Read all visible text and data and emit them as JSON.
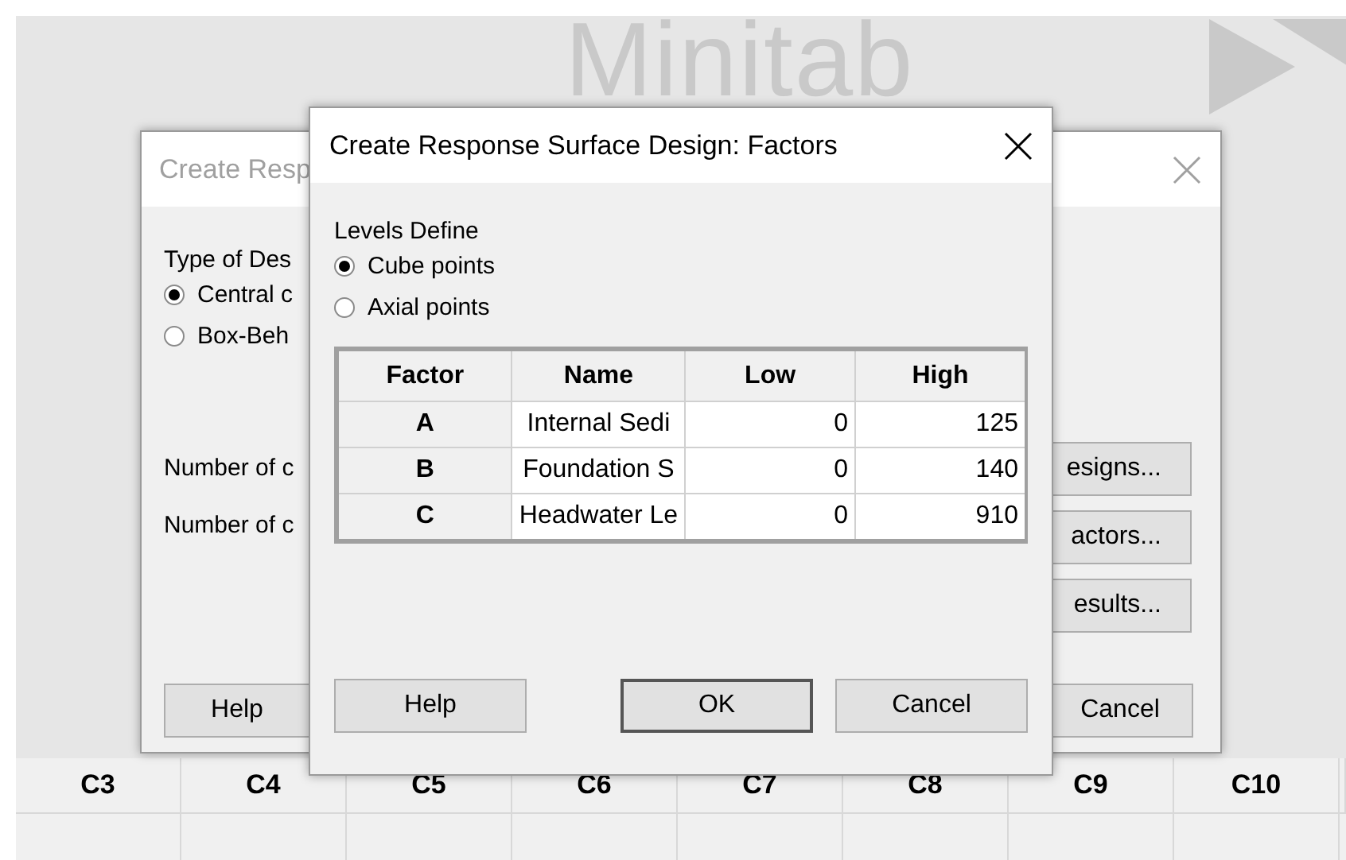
{
  "background_logo": {
    "text": "Minitab"
  },
  "back_dialog": {
    "title": "Create Resp",
    "type_label": "Type of Des",
    "options": [
      {
        "label": "Central c",
        "selected": true
      },
      {
        "label": "Box-Beh",
        "selected": false
      }
    ],
    "count_labels": [
      "Number of c",
      "Number of c"
    ],
    "side_buttons": [
      "esigns...",
      "actors...",
      "esults..."
    ],
    "footer_buttons": [
      "Help",
      "Cancel"
    ]
  },
  "front_dialog": {
    "title": "Create Response Surface Design: Factors",
    "group_label": "Levels Define",
    "options": [
      {
        "label": "Cube points",
        "selected": true
      },
      {
        "label": "Axial points",
        "selected": false
      }
    ],
    "table": {
      "columns": [
        "Factor",
        "Name",
        "Low",
        "High"
      ],
      "rows": [
        {
          "factor": "A",
          "name": "Internal Sedi",
          "low": "0",
          "high": "125"
        },
        {
          "factor": "B",
          "name": "Foundation S",
          "low": "0",
          "high": "140"
        },
        {
          "factor": "C",
          "name": "Headwater Le",
          "low": "0",
          "high": "910"
        }
      ]
    },
    "buttons": [
      {
        "label": "Help",
        "default": false
      },
      {
        "label": "OK",
        "default": true
      },
      {
        "label": "Cancel",
        "default": false
      }
    ]
  },
  "worksheet": {
    "columns": [
      "C3",
      "C4",
      "C5",
      "C6",
      "C7",
      "C8",
      "C9",
      "C10"
    ]
  }
}
